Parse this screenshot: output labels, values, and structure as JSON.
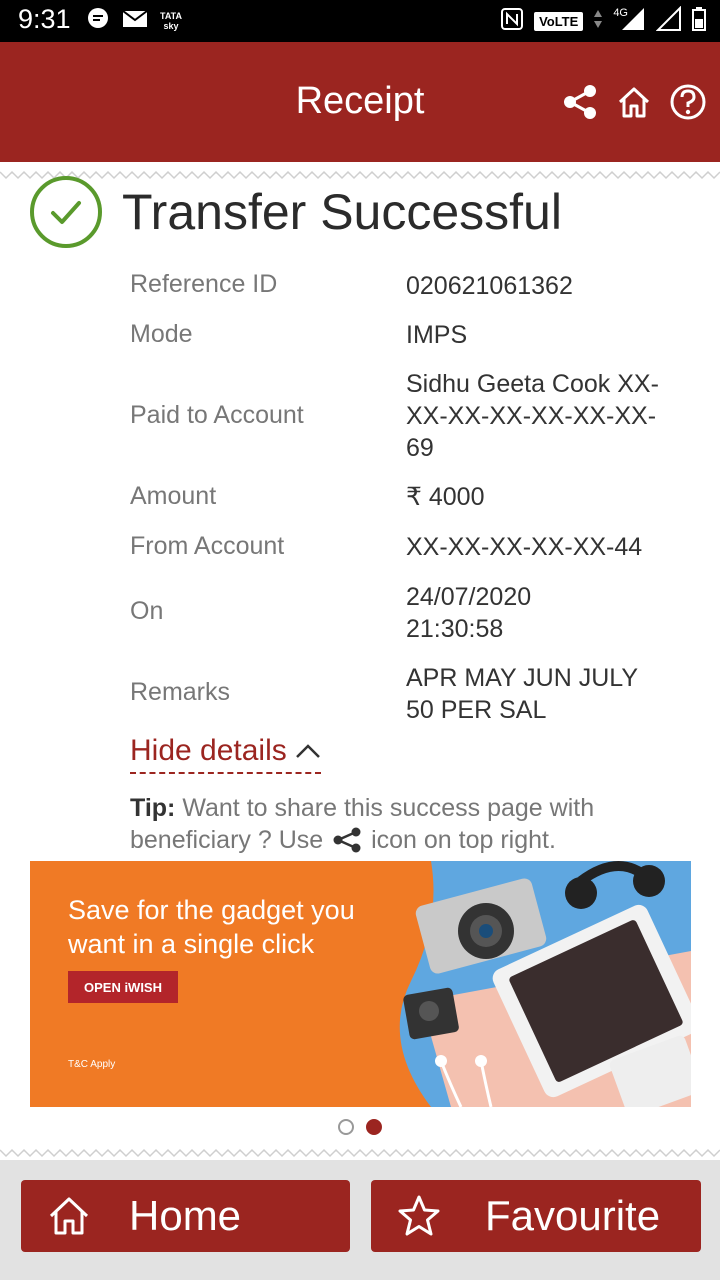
{
  "status_bar": {
    "time": "9:31",
    "carrier_top": "TATA",
    "carrier_bottom": "sky",
    "volte": "VoLTE",
    "network": "4G"
  },
  "header": {
    "title": "Receipt"
  },
  "result": {
    "title": "Transfer Successful"
  },
  "details": [
    {
      "label": "Reference ID",
      "value": "020621061362"
    },
    {
      "label": "Mode",
      "value": "IMPS"
    },
    {
      "label": "Paid to Account",
      "value": "Sidhu Geeta Cook XX-XX-XX-XX-XX-XX-XX-69"
    },
    {
      "label": "Amount",
      "value": "₹ 4000"
    },
    {
      "label": "From Account",
      "value": "XX-XX-XX-XX-XX-44"
    },
    {
      "label": "On",
      "value": "24/07/2020 21:30:58"
    },
    {
      "label": "Remarks",
      "value": "APR MAY JUN JULY 50 PER SAL"
    }
  ],
  "hide_details_label": "Hide details",
  "tip": {
    "prefix": "Tip:",
    "text_before_icon": "Want to share this success page with beneficiary ? Use",
    "text_after_icon": "icon on top right."
  },
  "banner": {
    "headline_line1": "Save for the gadget you",
    "headline_line2": "want in a single click",
    "button_label": "OPEN iWISH",
    "terms": "T&C Apply"
  },
  "carousel": {
    "count": 2,
    "active_index": 1
  },
  "footer": {
    "home_label": "Home",
    "favourite_label": "Favourite"
  },
  "colors": {
    "brand": "#9b2520",
    "success": "#5a9a2c",
    "banner_bg": "#f07a25"
  }
}
